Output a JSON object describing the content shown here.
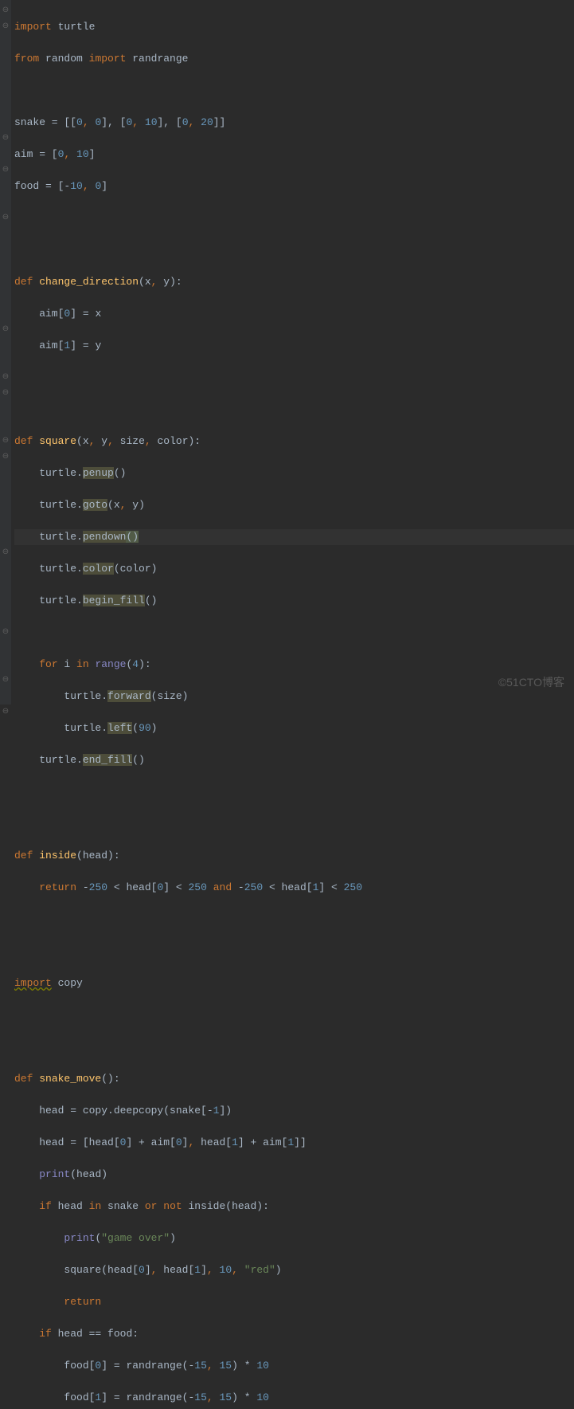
{
  "watermark": "©51CTO博客",
  "gutter": [
    "⊖",
    "⊖",
    "",
    "",
    "",
    "",
    "",
    "",
    "⊖",
    "",
    "⊖",
    "",
    "",
    "⊖",
    "",
    "",
    "",
    "",
    "",
    "",
    "⊖",
    "",
    "",
    "⊖",
    "⊖",
    "",
    "",
    "⊖",
    "⊖",
    "",
    "",
    "",
    "",
    "",
    "⊖",
    "",
    "",
    "",
    "",
    "⊖",
    "",
    "",
    "⊖",
    "",
    "⊖",
    ""
  ],
  "code": {
    "l1": {
      "a": "import",
      "b": " turtle"
    },
    "l2": {
      "a": "from",
      "b": " random ",
      "c": "import",
      "d": " randrange"
    },
    "l4": {
      "a": "snake = [[",
      "n1": "0",
      "c1": ", ",
      "n2": "0",
      "b": "], [",
      "n3": "0",
      "c2": ", ",
      "n4": "10",
      "d": "], [",
      "n5": "0",
      "c3": ", ",
      "n6": "20",
      "e": "]]"
    },
    "l5": {
      "a": "aim = [",
      "n1": "0",
      "c1": ", ",
      "n2": "10",
      "b": "]"
    },
    "l6": {
      "a": "food = [-",
      "n1": "10",
      "c1": ", ",
      "n2": "0",
      "b": "]"
    },
    "l9": {
      "a": "def ",
      "fn": "change_direction",
      "b": "(x",
      "c1": ",",
      "c": " y):"
    },
    "l10": {
      "a": "    aim[",
      "n": "0",
      "b": "] = x"
    },
    "l11": {
      "a": "    aim[",
      "n": "1",
      "b": "] = y"
    },
    "l14": {
      "a": "def ",
      "fn": "square",
      "b": "(x",
      "c1": ",",
      "c": " y",
      "c2": ",",
      "d": " size",
      "c3": ",",
      "e": " color):"
    },
    "l15": {
      "a": "    turtle.",
      "m": "penup",
      "b": "()"
    },
    "l16": {
      "a": "    turtle.",
      "m": "goto",
      "b": "(x",
      "c1": ",",
      "c": " y)"
    },
    "l17": {
      "a": "    turtle.",
      "m": "pendown",
      "b": "(",
      ")": ")"
    },
    "l18": {
      "a": "    turtle.",
      "m": "color",
      "b": "(color)"
    },
    "l19": {
      "a": "    turtle.",
      "m": "begin_fill",
      "b": "()"
    },
    "l21": {
      "a": "    ",
      "kw1": "for",
      "b": " i ",
      "kw2": "in",
      "c": " ",
      "bi": "range",
      "d": "(",
      "n": "4",
      "e": "):"
    },
    "l22": {
      "a": "        turtle.",
      "m": "forward",
      "b": "(size)"
    },
    "l23": {
      "a": "        turtle.",
      "m": "left",
      "b": "(",
      "n": "90",
      "c": ")"
    },
    "l24": {
      "a": "    turtle.",
      "m": "end_fill",
      "b": "()"
    },
    "l27": {
      "a": "def ",
      "fn": "inside",
      "b": "(head):"
    },
    "l28": {
      "a": "    ",
      "kw": "return",
      "b": " -",
      "n1": "250",
      "c": " < head[",
      "n2": "0",
      "d": "] < ",
      "n3": "250",
      "e": " ",
      "kw2": "and",
      "f": " -",
      "n4": "250",
      "g": " < head[",
      "n5": "1",
      "h": "] < ",
      "n6": "250"
    },
    "l31": {
      "a": "import",
      "b": " copy"
    },
    "l34": {
      "a": "def ",
      "fn": "snake_move",
      "b": "():"
    },
    "l35": {
      "a": "    head = copy.deepcopy(snake[-",
      "n": "1",
      "b": "])"
    },
    "l36": {
      "a": "    head = [head[",
      "n1": "0",
      "b": "] + aim[",
      "n2": "0",
      "c": "]",
      "c1": ",",
      "d": " head[",
      "n3": "1",
      "e": "] + aim[",
      "n4": "1",
      "f": "]]"
    },
    "l37": {
      "a": "    ",
      "bi": "print",
      "b": "(head)"
    },
    "l38": {
      "a": "    ",
      "kw1": "if",
      "b": " head ",
      "kw2": "in",
      "c": " snake ",
      "kw3": "or not",
      "d": " inside(head):"
    },
    "l39": {
      "a": "        ",
      "bi": "print",
      "b": "(",
      "str": "\"game over\"",
      "c": ")"
    },
    "l40": {
      "a": "        square(head[",
      "n1": "0",
      "b": "]",
      "c1": ",",
      "c": " head[",
      "n2": "1",
      "d": "]",
      "c2": ",",
      "e": " ",
      "n3": "10",
      "c3": ",",
      "f": " ",
      "str": "\"red\"",
      "g": ")"
    },
    "l41": {
      "a": "        ",
      "kw": "return"
    },
    "l42": {
      "a": "    ",
      "kw": "if",
      "b": " head == food:"
    },
    "l43": {
      "a": "        food[",
      "n1": "0",
      "b": "] = randrange(-",
      "n2": "15",
      "c1": ",",
      "c": " ",
      "n3": "15",
      "d": ") * ",
      "n4": "10"
    },
    "l44": {
      "a": "        food[",
      "n1": "1",
      "b": "] = randrange(-",
      "n2": "15",
      "c1": ",",
      "c": " ",
      "n3": "15",
      "d": ") * ",
      "n4": "10"
    }
  }
}
